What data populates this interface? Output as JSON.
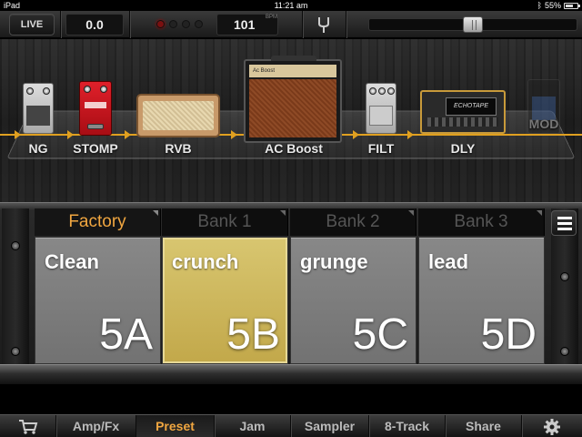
{
  "status_bar": {
    "device": "iPad",
    "time": "11:21 am",
    "battery": "55%"
  },
  "toolbar": {
    "live_label": "LIVE",
    "input_level": "0.0",
    "bpm_value": "101",
    "bpm_unit": "BPM",
    "tuner_icon": "tuning-fork-icon",
    "master_volume": 0.5
  },
  "signal_chain": {
    "modules": [
      {
        "id": "ng",
        "label": "NG",
        "active": true
      },
      {
        "id": "stomp",
        "label": "STOMP",
        "active": true
      },
      {
        "id": "rvb",
        "label": "RVB",
        "active": true
      },
      {
        "id": "acboost",
        "label": "AC Boost",
        "active": true,
        "panel_text": "Ac Boost"
      },
      {
        "id": "filt",
        "label": "FILT",
        "active": true
      },
      {
        "id": "dly",
        "label": "DLY",
        "active": true,
        "screen_text": "ECHOTAPE"
      },
      {
        "id": "mod",
        "label": "MOD",
        "active": false
      }
    ],
    "cable_color": "#e0a020"
  },
  "banks": {
    "tabs": [
      "Factory",
      "Bank 1",
      "Bank 2",
      "Bank 3"
    ],
    "selected_tab": "Factory",
    "menu_icon": "hamburger-menu-icon",
    "presets": [
      {
        "name": "Clean",
        "slot": "5A",
        "selected": false
      },
      {
        "name": "crunch",
        "slot": "5B",
        "selected": true
      },
      {
        "name": "grunge",
        "slot": "5C",
        "selected": false
      },
      {
        "name": "lead",
        "slot": "5D",
        "selected": false
      }
    ],
    "accent_color": "#f0a640"
  },
  "tabbar": {
    "items": [
      {
        "icon": "shopping-cart-icon"
      },
      {
        "label": "Amp/Fx"
      },
      {
        "label": "Preset",
        "active": true
      },
      {
        "label": "Jam"
      },
      {
        "label": "Sampler"
      },
      {
        "label": "8-Track"
      },
      {
        "label": "Share"
      },
      {
        "icon": "gear-icon"
      }
    ]
  }
}
